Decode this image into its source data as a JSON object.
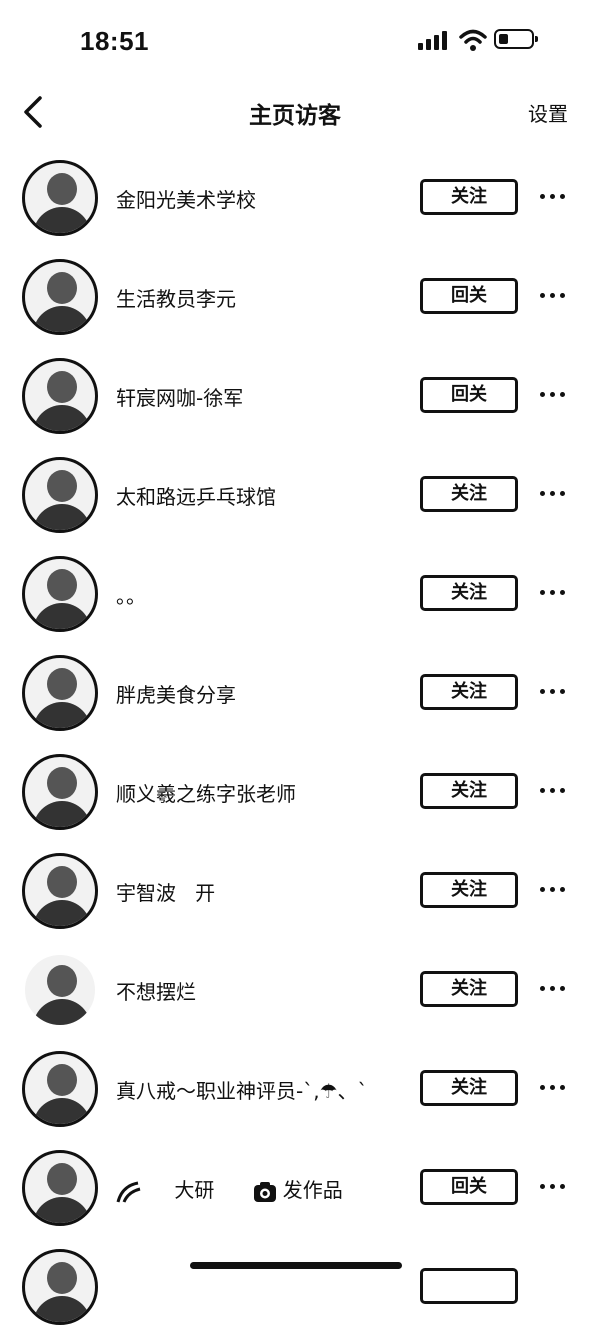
{
  "status_bar": {
    "time": "18:51"
  },
  "nav": {
    "title": "主页访客",
    "settings": "设置"
  },
  "visitors": [
    {
      "name": "金阳光美术学校",
      "action": "关注"
    },
    {
      "name": "生活教员李元",
      "action": "回关"
    },
    {
      "name": "轩宸网咖-徐军",
      "action": "回关"
    },
    {
      "name": "太和路远乒乓球馆",
      "action": "关注"
    },
    {
      "name": "。。",
      "action": "关注"
    },
    {
      "name": "胖虎美食分享",
      "action": "关注"
    },
    {
      "name": "顺义羲之练字张老师",
      "action": "关注"
    },
    {
      "name": "宇智波   开",
      "action": "关注"
    },
    {
      "name": "不想摆烂",
      "action": "关注"
    },
    {
      "name": "真八戒～职业神评员-`,☂、`",
      "action": "关注"
    },
    {
      "name": "大研",
      "extra": "发作品",
      "action": "回关"
    },
    {
      "name": "",
      "action": ""
    }
  ]
}
